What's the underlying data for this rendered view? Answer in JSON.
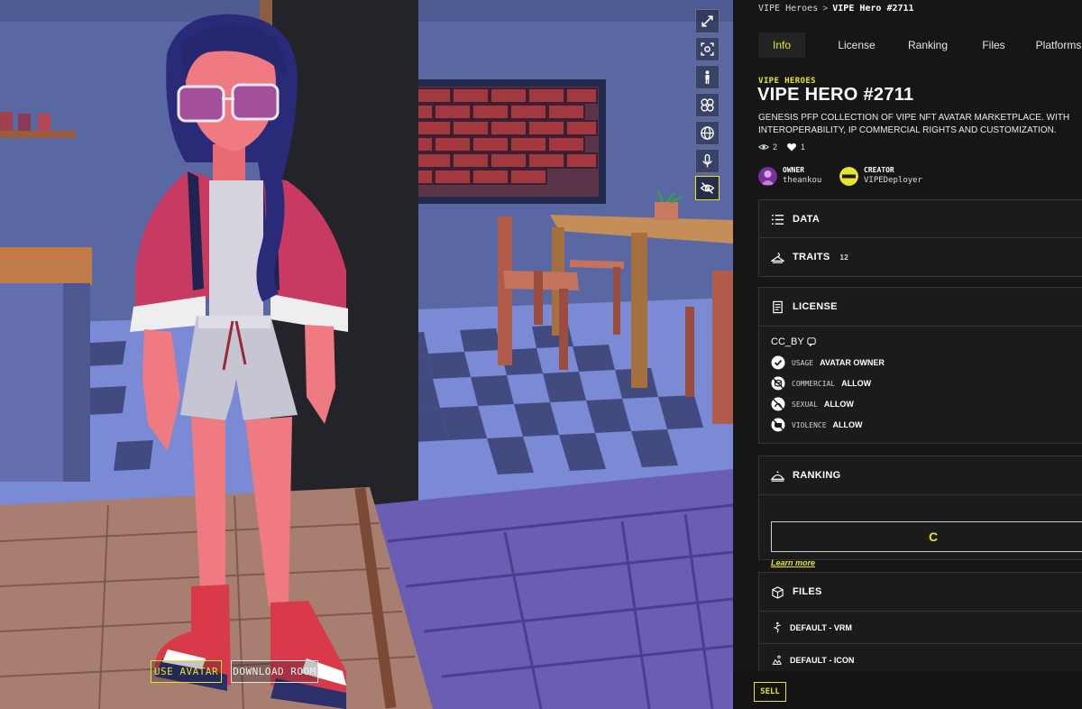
{
  "breadcrumb": {
    "collection": "VIPE Heroes",
    "separator": ">",
    "current": "VIPE Hero #2711"
  },
  "tabs": [
    {
      "label": "Info",
      "active": true
    },
    {
      "label": "License"
    },
    {
      "label": "Ranking"
    },
    {
      "label": "Files"
    },
    {
      "label": "Platforms"
    }
  ],
  "asset": {
    "collection_label": "VIPE HEROES",
    "title": "VIPE HERO #2711",
    "description_line1": "GENESIS PFP COLLECTION OF VIPE NFT AVATAR MARKETPLACE. WITH",
    "description_line2": "INTEROPERABILITY, IP COMMERCIAL RIGHTS AND CUSTOMIZATION.",
    "views": "2",
    "likes": "1"
  },
  "owner": {
    "role": "OWNER",
    "name": "theankou"
  },
  "creator": {
    "role": "CREATOR",
    "name": "VIPEDeployer"
  },
  "sections": {
    "data": {
      "title": "DATA",
      "icon": "list-icon"
    },
    "traits": {
      "title": "TRAITS",
      "count": "12",
      "icon": "hanger-icon"
    },
    "license": {
      "title": "LICENSE",
      "icon": "document-icon",
      "name": "CC_BY",
      "rows": [
        {
          "key": "USAGE",
          "value": "AVATAR OWNER",
          "icon": "check-circle-icon"
        },
        {
          "key": "COMMERCIAL",
          "value": "ALLOW",
          "icon": "coins-icon"
        },
        {
          "key": "SEXUAL",
          "value": "ALLOW",
          "icon": "no-sexual-icon"
        },
        {
          "key": "VIOLENCE",
          "value": "ALLOW",
          "icon": "fist-icon"
        }
      ]
    },
    "ranking": {
      "title": "RANKING",
      "icon": "podium-icon",
      "grade": "C",
      "learn_more": "Learn more"
    },
    "files": {
      "title": "FILES",
      "icon": "box-icon",
      "items": [
        {
          "label": "DEFAULT - VRM",
          "icon": "figure-icon"
        },
        {
          "label": "DEFAULT - ICON",
          "icon": "image-icon"
        }
      ]
    }
  },
  "viewport": {
    "use_avatar": "USE AVATAR",
    "download_room": "DOWNLOAD ROOM",
    "tools": [
      "fullscreen-icon",
      "camera-icon",
      "person-icon",
      "mesh-icon",
      "globe-icon",
      "microphone-icon",
      "hide-eye-icon"
    ]
  },
  "actions": {
    "sell": "SELL"
  },
  "colors": {
    "accent": "#e8e331",
    "panel_bg": "#161616",
    "card_border": "#353535"
  }
}
